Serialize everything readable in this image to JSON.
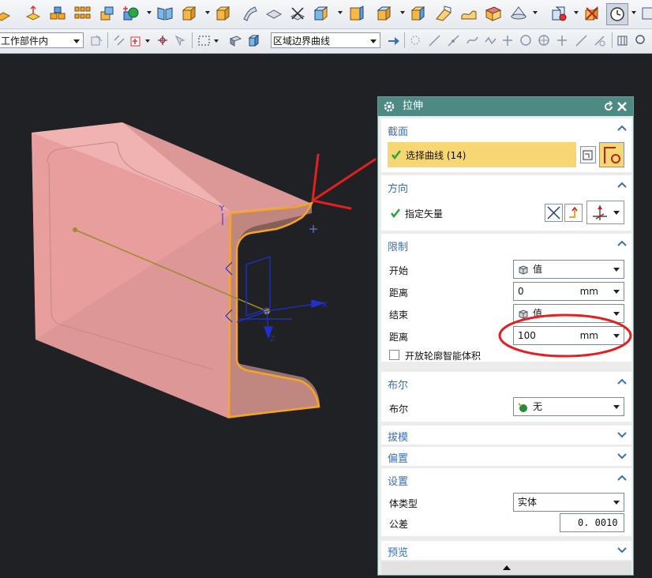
{
  "toolbar": {
    "icons": [
      "surface-tool-icon",
      "datum-plane-icon",
      "group-icon",
      "array-icon",
      "edit-face-icon",
      "sketch-point-icon",
      "book-icon",
      "block-icon",
      "box-icon",
      "sheet-icon",
      "surface-icon",
      "lines-icon",
      "extract-icon",
      "chamfer-icon",
      "cube-icon",
      "cube-dark-icon",
      "cube-face-icon",
      "wave-surface-icon",
      "ruled-surface-icon",
      "cone-surface-icon",
      "assembly-icon",
      "measure-icon",
      "clock-icon"
    ],
    "filter_combo": "工作部件内",
    "curve_rule_combo": "区域边界曲线"
  },
  "viewport": {
    "axis_y": "Y",
    "axis_x": "X",
    "axis_z": "Z"
  },
  "dialog": {
    "title": "拉伸",
    "section": {
      "header": "截面",
      "select_curve": "选择曲线 (14)"
    },
    "direction": {
      "header": "方向",
      "specify_vector": "指定矢量"
    },
    "limits": {
      "header": "限制",
      "start_label": "开始",
      "start_value": "值",
      "start_distance_label": "距离",
      "start_distance": "0",
      "end_label": "结束",
      "end_value": "值",
      "end_distance_label": "距离",
      "end_distance": "100",
      "unit": "mm",
      "open_profile": "开放轮廓智能体积"
    },
    "boolean": {
      "header": "布尔",
      "label": "布尔",
      "value": "无"
    },
    "draft": {
      "header": "拔模"
    },
    "offset": {
      "header": "偏置"
    },
    "settings": {
      "header": "设置",
      "body_type_label": "体类型",
      "body_type": "实体",
      "tolerance_label": "公差",
      "tolerance": "0. 0010"
    },
    "preview": {
      "header": "预览"
    }
  },
  "colors": {
    "title_bar": "#4e8a84",
    "section_header": "#3b6fb7",
    "highlight": "#f7d774",
    "solid": "#e9a3a0",
    "annotation": "#e32020"
  }
}
